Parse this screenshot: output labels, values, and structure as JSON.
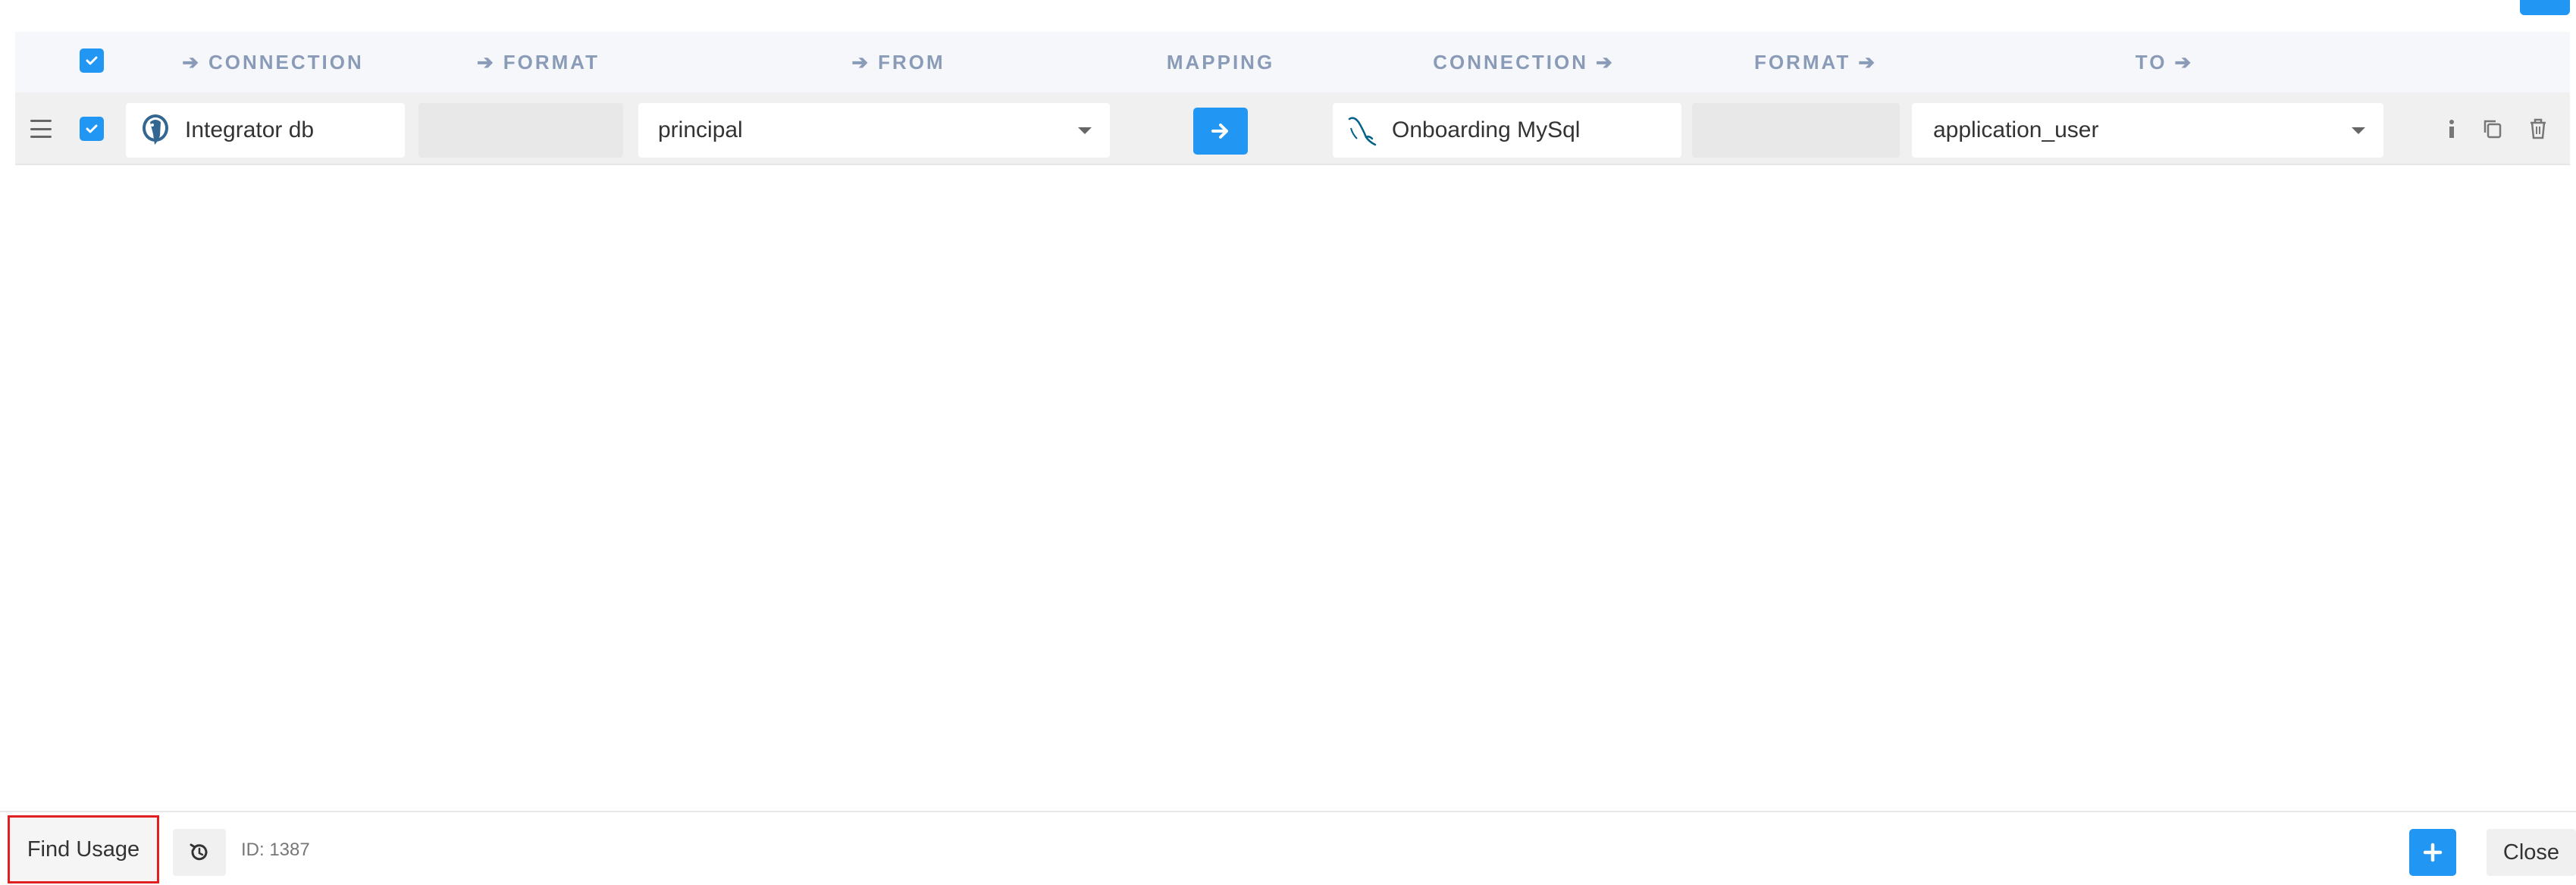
{
  "header": {
    "columns": [
      {
        "label": "CONNECTION",
        "arrow": "before"
      },
      {
        "label": "FORMAT",
        "arrow": "before"
      },
      {
        "label": "FROM",
        "arrow": "before"
      },
      {
        "label": "MAPPING",
        "arrow": "none"
      },
      {
        "label": "CONNECTION",
        "arrow": "after"
      },
      {
        "label": "FORMAT",
        "arrow": "after"
      },
      {
        "label": "TO",
        "arrow": "after"
      }
    ],
    "arrow_glyph": "➔",
    "select_all_checked": true
  },
  "row": {
    "checked": true,
    "source_connection": {
      "name": "Integrator db",
      "icon": "postgresql-icon"
    },
    "source_format": "",
    "from_entity": "principal",
    "mapping_icon": "arrow-right-icon",
    "target_connection": {
      "name": "Onboarding MySql",
      "icon": "mysql-icon"
    },
    "target_format": "",
    "to_entity": "application_user",
    "actions": [
      {
        "name": "info-icon",
        "glyph": "ℹ"
      },
      {
        "name": "copy-icon",
        "glyph": "⧉"
      },
      {
        "name": "delete-icon",
        "glyph": "🗑"
      }
    ]
  },
  "footer": {
    "find_usage_label": "Find Usage",
    "history_icon": "history-icon",
    "id_text": "ID: 1387",
    "add_icon": "plus-icon",
    "close_label": "Close"
  },
  "colors": {
    "accent": "#2196f3",
    "header_text": "#8a9bb8",
    "highlight_border": "#e02020"
  }
}
